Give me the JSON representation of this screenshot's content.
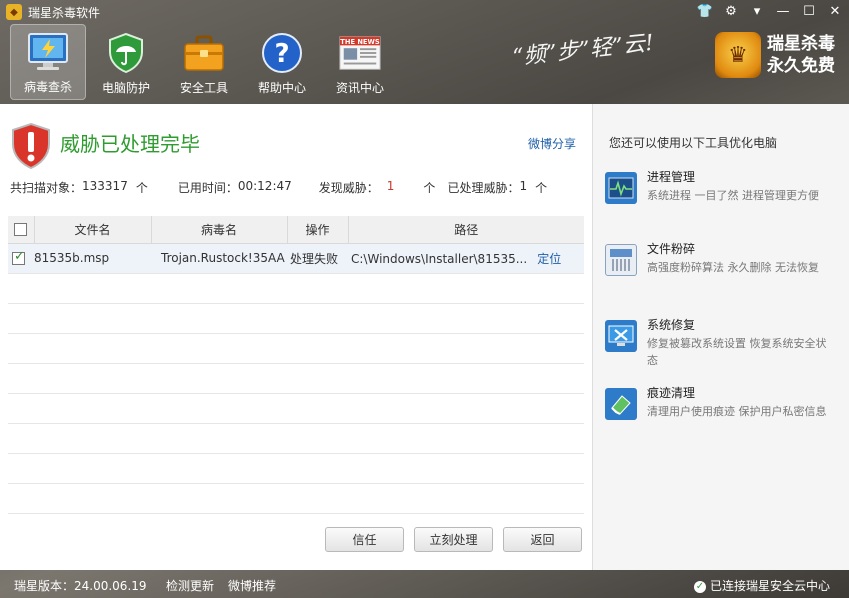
{
  "window": {
    "title": "瑞星杀毒软件",
    "controls": [
      "shirt-icon",
      "gear-icon",
      "menu-icon",
      "minimize-icon",
      "maximize-icon",
      "close-icon"
    ]
  },
  "nav": {
    "items": [
      {
        "label": "病毒查杀",
        "icon": "monitor-scan-icon",
        "active": true
      },
      {
        "label": "电脑防护",
        "icon": "umbrella-shield-icon",
        "active": false
      },
      {
        "label": "安全工具",
        "icon": "toolbox-icon",
        "active": false
      },
      {
        "label": "帮助中心",
        "icon": "help-icon",
        "active": false
      },
      {
        "label": "资讯中心",
        "icon": "news-icon",
        "active": false
      }
    ],
    "news_icon_text": "THE NEWS"
  },
  "slogan": "“频”步”轻”云!",
  "brand": {
    "line1": "瑞星杀毒",
    "line2": "永久免费"
  },
  "result": {
    "title": "威胁已处理完毕",
    "share": "微博分享",
    "stats": {
      "scanned_label": "共扫描对象：",
      "scanned_value": "133317",
      "scanned_unit": "个",
      "time_label": "已用时间：",
      "time_value": "00:12:47",
      "found_label": "发现威胁：",
      "found_value": "1",
      "found_unit": "个",
      "handled_label": "已处理威胁：",
      "handled_value": "1",
      "handled_unit": "个"
    }
  },
  "table": {
    "headers": [
      "文件名",
      "病毒名",
      "操作",
      "路径"
    ],
    "rows": [
      {
        "filename": "81535b.msp",
        "virus": "Trojan.Rustock!35AA",
        "action": "处理失败",
        "path": "C:\\Windows\\Installer\\81535...",
        "locate": "定位"
      }
    ]
  },
  "buttons": {
    "trust": "信任",
    "process": "立刻处理",
    "back": "返回"
  },
  "tools": {
    "title": "您还可以使用以下工具优化电脑",
    "items": [
      {
        "name": "进程管理",
        "desc": "系统进程 一目了然 进程管理更方便",
        "icon": "process-monitor-icon"
      },
      {
        "name": "文件粉碎",
        "desc": "高强度粉碎算法 永久删除 无法恢复",
        "icon": "file-shredder-icon"
      },
      {
        "name": "系统修复",
        "desc": "修复被篡改系统设置 恢复系统安全状态",
        "icon": "system-repair-icon"
      },
      {
        "name": "痕迹清理",
        "desc": "清理用户使用痕迹 保护用户私密信息",
        "icon": "eraser-icon"
      }
    ]
  },
  "status": {
    "version": "瑞星版本：24.00.06.19",
    "update": "检测更新",
    "weibo": "微博推荐",
    "cloud": "已连接瑞星安全云中心"
  },
  "colors": {
    "accent_green": "#2f9c2f",
    "link_blue": "#1f5fa8",
    "threat_red": "#c83a2a"
  }
}
